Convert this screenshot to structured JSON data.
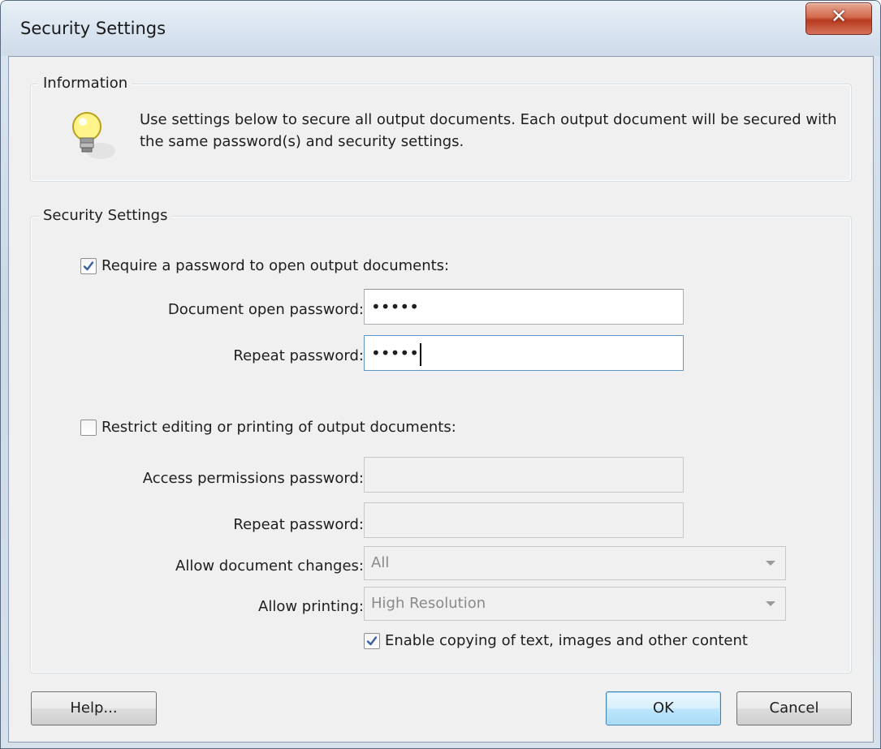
{
  "window": {
    "title": "Security Settings",
    "close_symbol": "✕"
  },
  "information": {
    "legend": "Information",
    "icon": "lightbulb-icon",
    "text": "Use settings below to secure all output documents. Each output document will be secured with the same password(s) and security settings."
  },
  "security": {
    "legend": "Security Settings",
    "require_open_password": {
      "label": "Require a password to open output documents:",
      "checked": true,
      "open_password_label": "Document open password:",
      "open_password_value": "•••••",
      "repeat_password_label": "Repeat password:",
      "repeat_password_value": "•••••"
    },
    "restrict_editing": {
      "label": "Restrict editing or printing of output documents:",
      "checked": false,
      "permissions_password_label": "Access permissions password:",
      "permissions_password_value": "",
      "repeat_password_label": "Repeat password:",
      "repeat_password_value": "",
      "allow_changes_label": "Allow document changes:",
      "allow_changes_value": "All",
      "allow_printing_label": "Allow printing:",
      "allow_printing_value": "High Resolution",
      "enable_copying_label": "Enable copying of text, images and other content",
      "enable_copying_checked": true
    }
  },
  "buttons": {
    "help": "Help...",
    "ok": "OK",
    "cancel": "Cancel"
  },
  "colors": {
    "accent": "#3c7fb1",
    "close": "#c4472b",
    "checkmark": "#3c5fa0"
  }
}
